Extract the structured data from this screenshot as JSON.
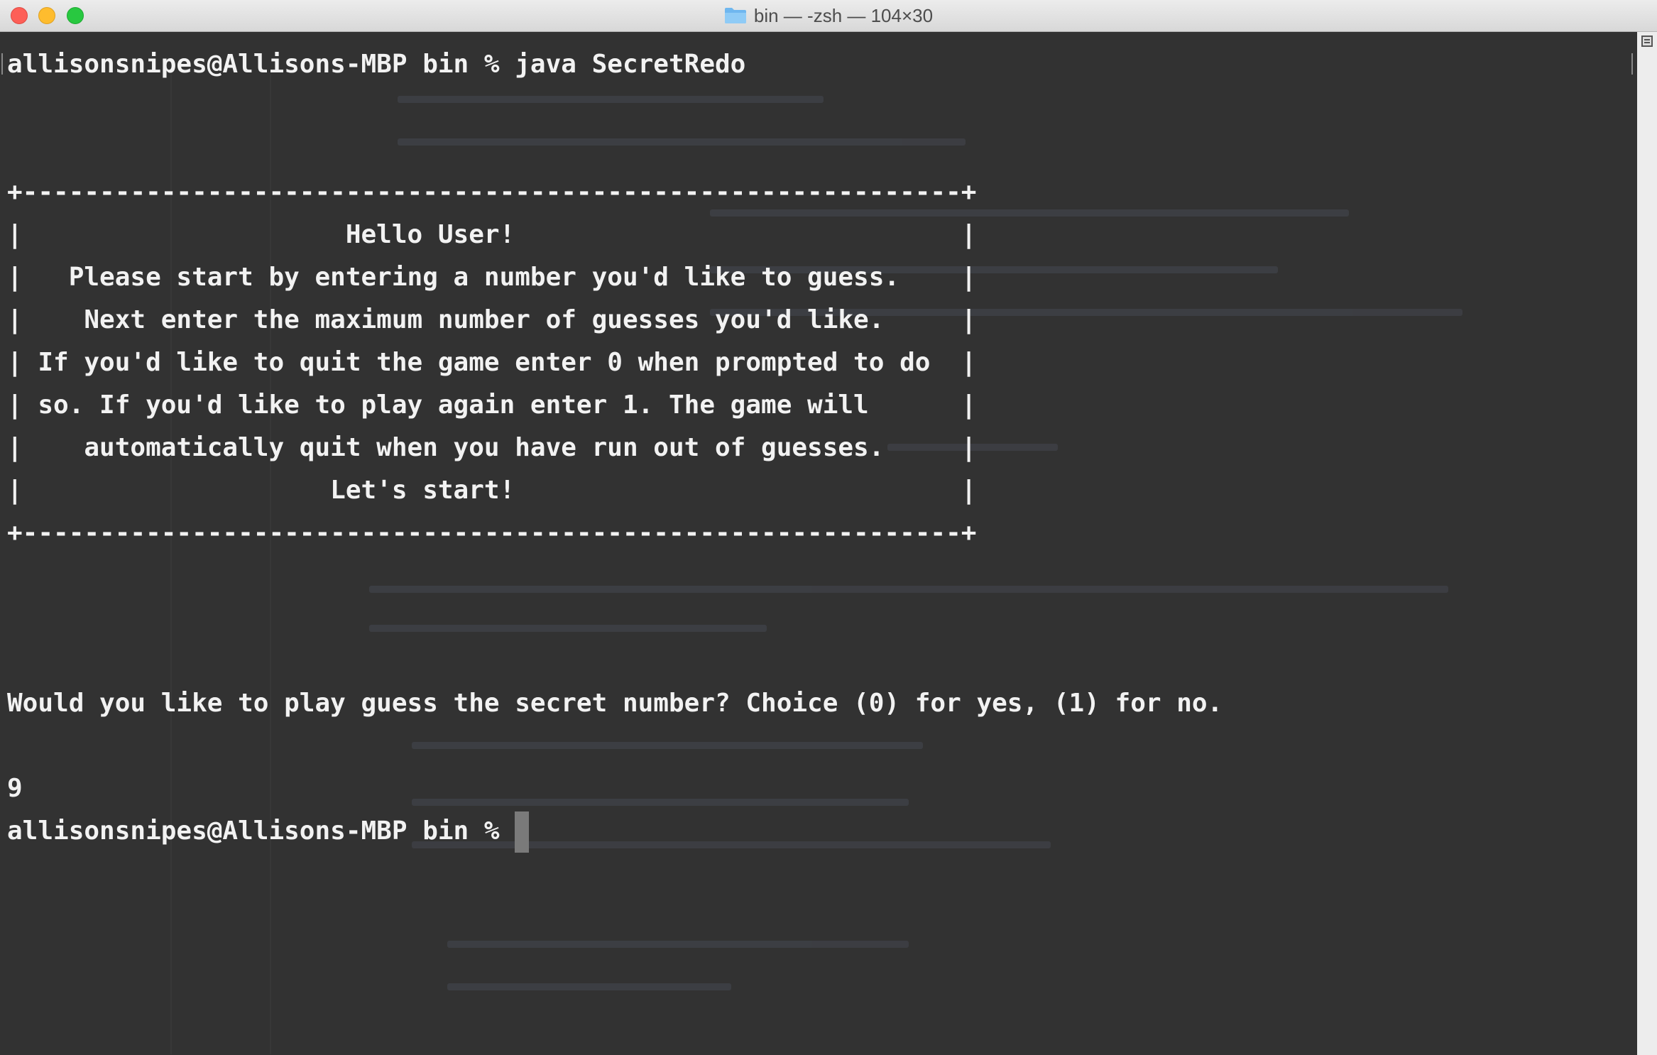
{
  "window": {
    "title": "bin — -zsh — 104×30",
    "folder_icon": "folder-icon"
  },
  "terminal": {
    "lines": [
      "allisonsnipes@Allisons-MBP bin % java SecretRedo",
      "",
      "",
      "+-------------------------------------------------------------+",
      "|                     Hello User!                             |",
      "|   Please start by entering a number you'd like to guess.    |",
      "|    Next enter the maximum number of guesses you'd like.     |",
      "| If you'd like to quit the game enter 0 when prompted to do  |",
      "| so. If you'd like to play again enter 1. The game will      |",
      "|    automatically quit when you have run out of guesses.     |",
      "|                    Let's start!                             |",
      "+-------------------------------------------------------------+",
      "",
      "",
      "",
      "Would you like to play guess the secret number? Choice (0) for yes, (1) for no.",
      "",
      "9",
      "allisonsnipes@Allisons-MBP bin % "
    ],
    "cursor_color": "#7a7a7a",
    "text_color": "#f2f2f2",
    "background": "#323232"
  }
}
